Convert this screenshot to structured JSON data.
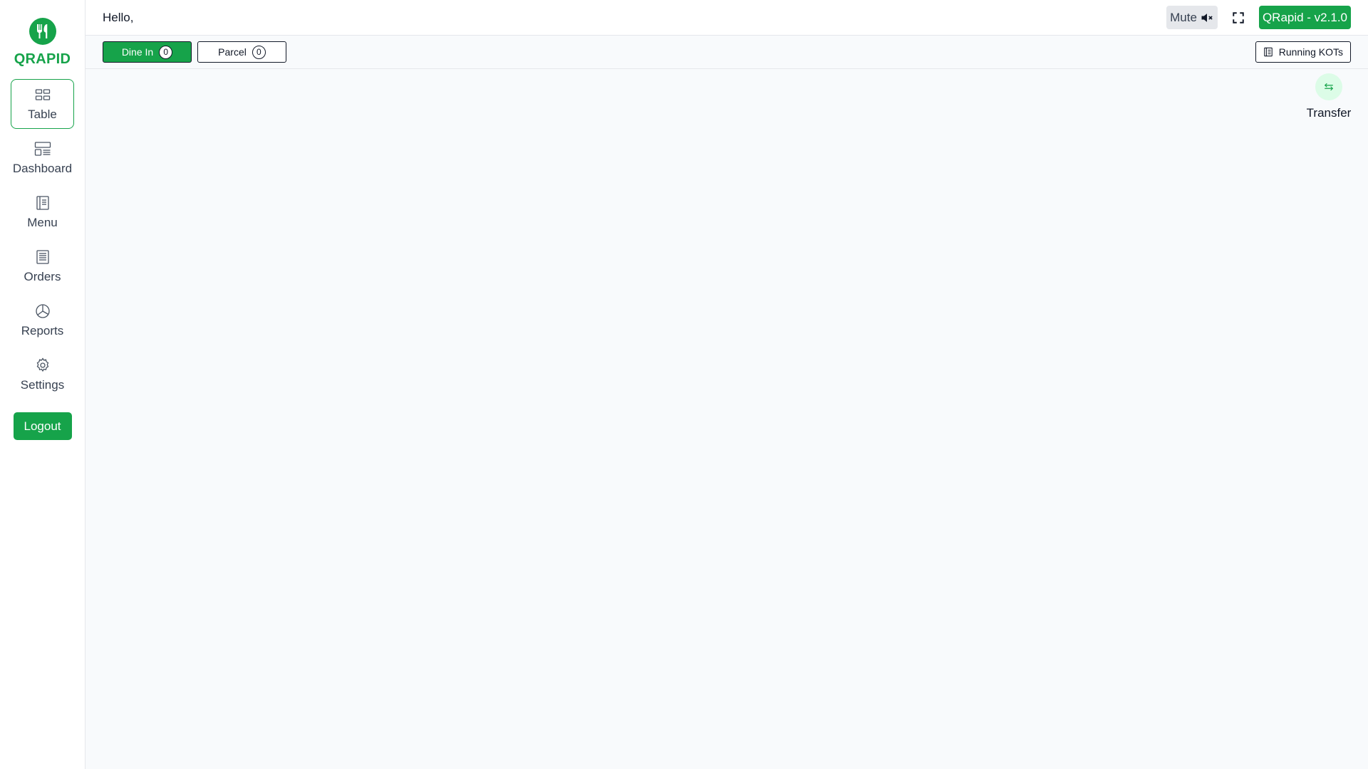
{
  "brand": {
    "name": "QRAPID",
    "color": "#16a34a",
    "logo_icon": "utensils-logo-icon"
  },
  "sidebar": {
    "items": [
      {
        "label": "Table",
        "icon": "table-grid-icon",
        "active": true
      },
      {
        "label": "Dashboard",
        "icon": "dashboard-icon",
        "active": false
      },
      {
        "label": "Menu",
        "icon": "menu-book-icon",
        "active": false
      },
      {
        "label": "Orders",
        "icon": "orders-list-icon",
        "active": false
      },
      {
        "label": "Reports",
        "icon": "pie-chart-icon",
        "active": false
      },
      {
        "label": "Settings",
        "icon": "gear-icon",
        "active": false
      }
    ],
    "logout_label": "Logout"
  },
  "header": {
    "greeting": "Hello,",
    "mute_label": "Mute",
    "mute_icon": "speaker-muted-icon",
    "fullscreen_icon": "fullscreen-icon",
    "version": "QRapid - v2.1.0"
  },
  "tabs": [
    {
      "label": "Dine In",
      "count": "0",
      "active": true
    },
    {
      "label": "Parcel",
      "count": "0",
      "active": false
    }
  ],
  "running_kots": {
    "label": "Running KOTs",
    "icon": "receipt-icon"
  },
  "transfer": {
    "label": "Transfer",
    "icon": "transfer-arrows-icon"
  }
}
